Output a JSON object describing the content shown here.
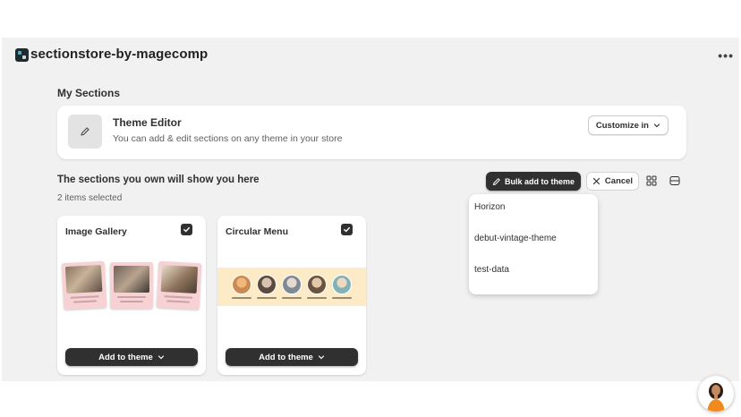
{
  "app": {
    "title": "sectionstore-by-magecomp"
  },
  "my_sections": {
    "heading": "My Sections",
    "editor": {
      "title": "Theme Editor",
      "description": "You can add & edit sections on any theme in your store",
      "customize_label": "Customize in"
    }
  },
  "owned": {
    "heading": "The sections you own will show you here",
    "selected_text": "2 items selected",
    "bulk_label": "Bulk add to theme",
    "cancel_label": "Cancel"
  },
  "theme_dropdown": {
    "items": [
      "Horizon",
      "debut-vintage-theme",
      "test-data"
    ]
  },
  "cards": [
    {
      "title": "Image Gallery",
      "checked": true,
      "button_label": "Add to theme"
    },
    {
      "title": "Circular Menu",
      "checked": true,
      "button_label": "Add to theme"
    }
  ],
  "colors": {
    "primary_button": "#303030",
    "page_background": "#f1f1f1",
    "gallery_tile": "#f6d2d4",
    "circle_strip": "#fdebc8"
  },
  "icons": [
    "app-logo-icon",
    "more-icon",
    "pencil-icon",
    "chevron-down-icon",
    "close-icon",
    "grid-view-icon",
    "list-view-icon",
    "checkmark-icon"
  ]
}
